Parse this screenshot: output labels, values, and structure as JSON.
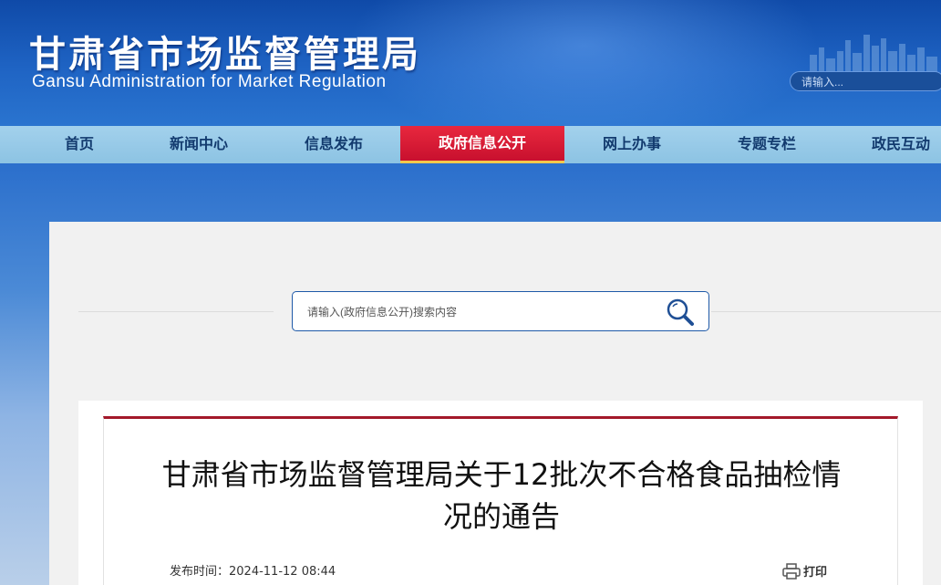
{
  "header": {
    "title_cn": "甘肃省市场监督管理局",
    "title_en": "Gansu Administration for Market Regulation",
    "search_placeholder": "请输入..."
  },
  "nav": {
    "items": [
      {
        "label": "首页"
      },
      {
        "label": "新闻中心"
      },
      {
        "label": "信息发布"
      },
      {
        "label": "政府信息公开",
        "active": true
      },
      {
        "label": "网上办事"
      },
      {
        "label": "专题专栏"
      },
      {
        "label": "政民互动"
      }
    ]
  },
  "search": {
    "placeholder": "请输入(政府信息公开)搜索内容",
    "icon": "search-icon"
  },
  "article": {
    "title": "甘肃省市场监督管理局关于12批次不合格食品抽检情况的通告",
    "meta_label": "发布时间：",
    "publish_time": "2024-11-12 08:44",
    "print_label": "打印"
  },
  "colors": {
    "header_blue": "#1f64c4",
    "nav_bg": "#a3d1ec",
    "nav_active": "#d81b34",
    "accent_red": "#a3182a"
  }
}
